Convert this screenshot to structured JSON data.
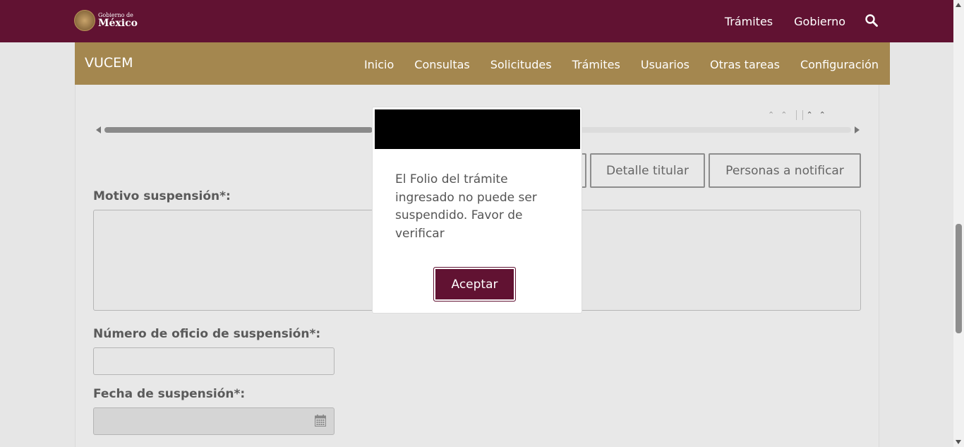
{
  "gov_header": {
    "logo_small": "Gobierno de",
    "logo_big": "México",
    "nav": [
      "Trámites",
      "Gobierno"
    ],
    "search_icon": "search-icon"
  },
  "vucem": {
    "title": "VUCEM",
    "nav": [
      "Inicio",
      "Consultas",
      "Solicitudes",
      "Trámites",
      "Usuarios",
      "Otras tareas",
      "Configuración"
    ]
  },
  "tabs": {
    "detalle_titular": "Detalle titular",
    "personas_notificar": "Personas a notificar"
  },
  "form": {
    "motivo_label": "Motivo suspensión*:",
    "oficio_label": "Número de oficio de suspensión*:",
    "fecha_label": "Fecha de suspensión*:",
    "motivo_value": "",
    "oficio_value": "",
    "fecha_value": "",
    "calendar_icon": "calendar-icon"
  },
  "modal": {
    "message": "El Folio del trámite ingresado no puede ser suspendido. Favor de verificar",
    "button_label": "Aceptar"
  },
  "colors": {
    "gov_bar": "#611232",
    "vucem_bar": "#a4874f",
    "modal_header": "#000000",
    "primary_button": "#611232"
  }
}
